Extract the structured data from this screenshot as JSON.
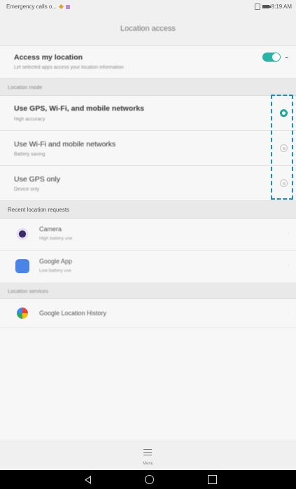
{
  "status_bar": {
    "carrier_text": "Emergency calls o...",
    "time": "8:19 AM"
  },
  "header": {
    "title": "Location access"
  },
  "access": {
    "title": "Access my location",
    "subtitle": "Let selected apps access your location information",
    "enabled": true
  },
  "location_mode": {
    "section_label": "Location mode",
    "options": [
      {
        "title": "Use GPS, Wi-Fi, and mobile networks",
        "subtitle": "High accuracy",
        "selected": true
      },
      {
        "title": "Use Wi-Fi and mobile networks",
        "subtitle": "Battery saving",
        "selected": false
      },
      {
        "title": "Use GPS only",
        "subtitle": "Device only",
        "selected": false
      }
    ]
  },
  "recent_requests": {
    "section_label": "Recent location requests",
    "apps": [
      {
        "name": "Camera",
        "detail": "High battery use",
        "icon": "camera-icon"
      },
      {
        "name": "Google App",
        "detail": "Low battery use",
        "icon": "google-icon"
      }
    ]
  },
  "location_services": {
    "section_label": "Location services",
    "items": [
      {
        "name": "Google Location History",
        "icon": "location-history-icon"
      }
    ]
  },
  "menu": {
    "label": "Menu"
  },
  "colors": {
    "accent": "#29b4a6",
    "callout": "#1a8fbf"
  }
}
